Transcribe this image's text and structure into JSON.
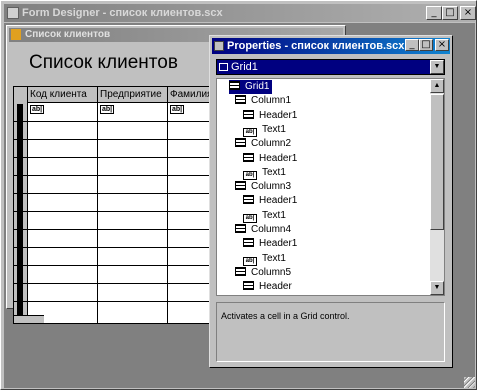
{
  "form_designer": {
    "title": "Form Designer - список клиентов.scx"
  },
  "form": {
    "title": "Список клиентов",
    "heading": "Список клиентов"
  },
  "grid": {
    "columns": [
      "Код клиента",
      "Предприятие",
      "Фамилия"
    ],
    "control_label": "ab|"
  },
  "properties": {
    "title": "Properties - список клиентов.scx",
    "selected_object": "Grid1",
    "description": "Activates a cell in a Grid control.",
    "tree": [
      {
        "label": "Grid1",
        "icon": "grid-icon",
        "selected": true
      },
      {
        "label": "Column1",
        "icon": "column-icon"
      },
      {
        "label": "Header1",
        "icon": "header-icon"
      },
      {
        "label": "Text1",
        "icon": "textbox-icon"
      },
      {
        "label": "Column2",
        "icon": "column-icon"
      },
      {
        "label": "Header1",
        "icon": "header-icon"
      },
      {
        "label": "Text1",
        "icon": "textbox-icon"
      },
      {
        "label": "Column3",
        "icon": "column-icon"
      },
      {
        "label": "Header1",
        "icon": "header-icon"
      },
      {
        "label": "Text1",
        "icon": "textbox-icon"
      },
      {
        "label": "Column4",
        "icon": "column-icon"
      },
      {
        "label": "Header1",
        "icon": "header-icon"
      },
      {
        "label": "Text1",
        "icon": "textbox-icon"
      },
      {
        "label": "Column5",
        "icon": "column-icon"
      },
      {
        "label": "Header",
        "icon": "header-icon"
      }
    ]
  },
  "colors": {
    "active_title": "#000080",
    "inactive_title": "#808080",
    "face": "#c0c0c0"
  }
}
